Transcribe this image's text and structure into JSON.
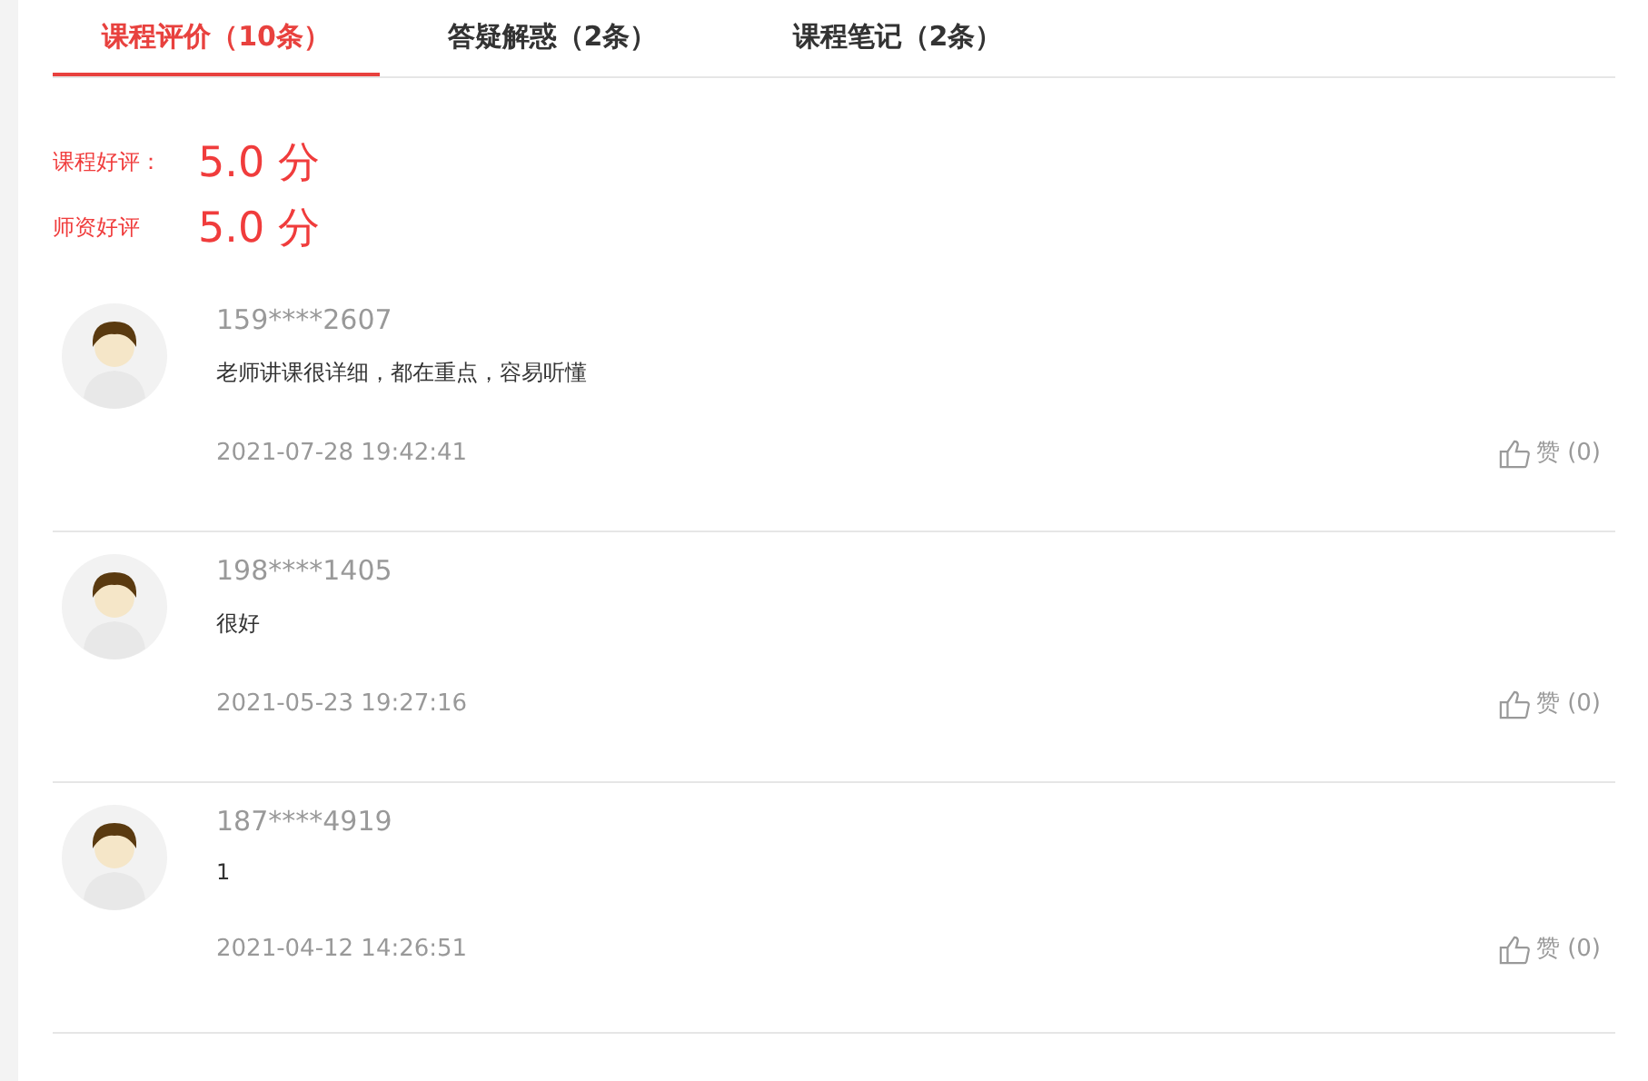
{
  "tabs": [
    {
      "label": "课程评价（10条）",
      "selected": true
    },
    {
      "label": "答疑解惑（2条）",
      "selected": false
    },
    {
      "label": "课程笔记（2条）",
      "selected": false
    }
  ],
  "ratings": [
    {
      "label": "课程好评：",
      "score": "5.0 分"
    },
    {
      "label": "师资好评",
      "score": "5.0 分"
    }
  ],
  "reviews": [
    {
      "user": "159****2607",
      "comment": "老师讲课很详细，都在重点，容易听懂",
      "time": "2021-07-28 19:42:41",
      "like_label": "赞",
      "like_count": "(0)"
    },
    {
      "user": "198****1405",
      "comment": "很好",
      "time": "2021-05-23 19:27:16",
      "like_label": "赞",
      "like_count": "(0)"
    },
    {
      "user": "187****4919",
      "comment": "1",
      "time": "2021-04-12 14:26:51",
      "like_label": "赞",
      "like_count": "(0)"
    }
  ]
}
